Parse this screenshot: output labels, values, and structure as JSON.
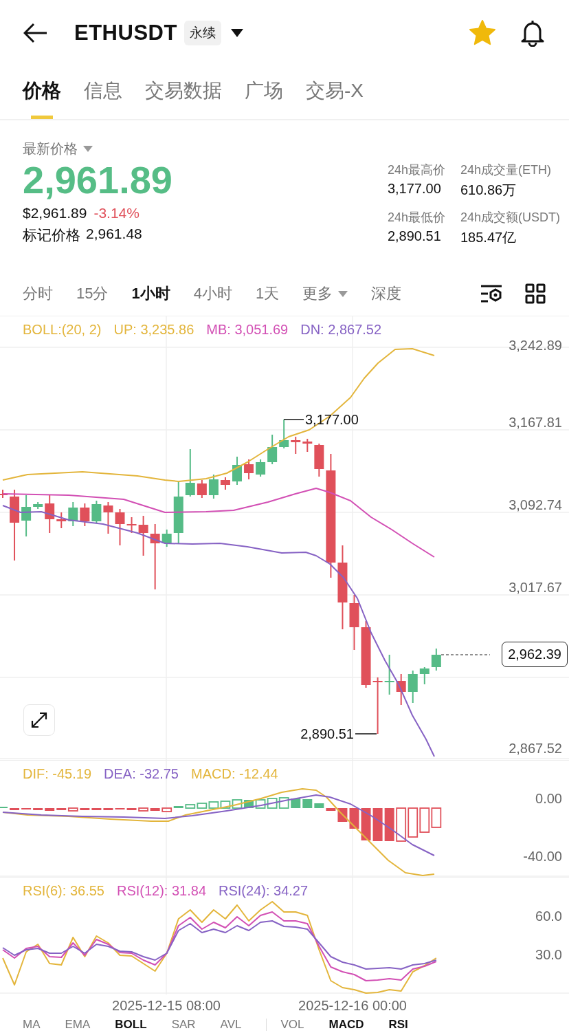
{
  "header": {
    "title": "ETHUSDT",
    "tag": "永续",
    "favorite": true
  },
  "tabs": [
    {
      "label": "价格",
      "selected": true
    },
    {
      "label": "信息",
      "selected": false
    },
    {
      "label": "交易数据",
      "selected": false
    },
    {
      "label": "广场",
      "selected": false
    },
    {
      "label": "交易-X",
      "selected": false
    }
  ],
  "price": {
    "label": "最新价格",
    "last": "2,961.89",
    "usd": "$2,961.89",
    "change": "-3.14%",
    "mark_label": "标记价格",
    "mark_value": "2,961.48"
  },
  "stats": [
    {
      "label": "24h最高价",
      "value": "3,177.00"
    },
    {
      "label": "24h成交量(ETH)",
      "value": "610.86万"
    },
    {
      "label": "24h最低价",
      "value": "2,890.51"
    },
    {
      "label": "24h成交额(USDT)",
      "value": "185.47亿"
    }
  ],
  "intervals": [
    {
      "label": "分时",
      "selected": false
    },
    {
      "label": "15分",
      "selected": false
    },
    {
      "label": "1小时",
      "selected": true
    },
    {
      "label": "4小时",
      "selected": false
    },
    {
      "label": "1天",
      "selected": false
    },
    {
      "label": "更多",
      "selected": false,
      "kind": "dropdown"
    },
    {
      "label": "深度",
      "selected": false
    }
  ],
  "main_chart": {
    "legend": [
      {
        "text": "BOLL:(20, 2)",
        "color": "#e3b53b"
      },
      {
        "text": "UP: 3,235.86",
        "color": "#e3b53b"
      },
      {
        "text": "MB: 3,051.69",
        "color": "#d24fb4"
      },
      {
        "text": "DN: 2,867.52",
        "color": "#8662c4"
      }
    ],
    "axis": [
      "3,242.89",
      "3,167.81",
      "3,092.74",
      "3,017.67",
      "2,867.52"
    ],
    "high_marker": "3,177.00",
    "low_marker": "2,890.51",
    "last_price": "2,962.39"
  },
  "macd": {
    "legend": [
      {
        "text": "DIF: -45.19",
        "color": "#e3b53b"
      },
      {
        "text": "DEA: -32.75",
        "color": "#8662c4"
      },
      {
        "text": "MACD: -12.44",
        "color": "#e3b53b"
      }
    ],
    "axis": [
      "0.00",
      "-40.00"
    ]
  },
  "rsi": {
    "legend": [
      {
        "text": "RSI(6): 36.55",
        "color": "#e3b53b"
      },
      {
        "text": "RSI(12): 31.84",
        "color": "#d24fb4"
      },
      {
        "text": "RSI(24): 34.27",
        "color": "#8662c4"
      }
    ],
    "axis": [
      "60.0",
      "30.0"
    ]
  },
  "dates": [
    "2025-12-15 08:00",
    "2025-12-16 00:00"
  ],
  "indicators": {
    "main": [
      {
        "label": "MA",
        "selected": false
      },
      {
        "label": "EMA",
        "selected": false
      },
      {
        "label": "BOLL",
        "selected": true
      },
      {
        "label": "SAR",
        "selected": false
      },
      {
        "label": "AVL",
        "selected": false
      }
    ],
    "sub": [
      {
        "label": "VOL",
        "selected": false
      },
      {
        "label": "MACD",
        "selected": true
      },
      {
        "label": "RSI",
        "selected": true
      }
    ]
  }
}
